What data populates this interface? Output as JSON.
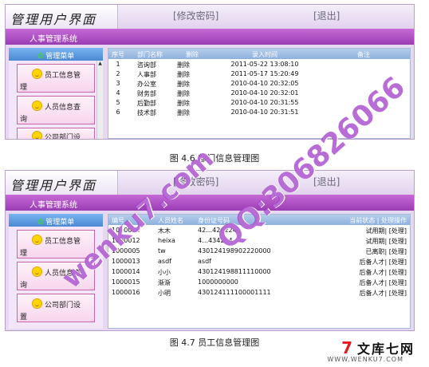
{
  "screen1": {
    "logo": "管理用户界面",
    "change_password": "[修改密码]",
    "logout": "[退出]",
    "system_title": "人事管理系统",
    "side_menu_title": "管理菜单",
    "menu": [
      {
        "label": "员工信息管",
        "label2": "理"
      },
      {
        "label": "人员信息查",
        "label2": "询"
      },
      {
        "label": "公司部门设",
        "label2": ""
      }
    ],
    "table": {
      "headers": [
        "序号",
        "部门名称",
        "删除",
        "录入时间",
        "备注"
      ],
      "rows": [
        {
          "no": "1",
          "name": "咨询部",
          "del": "删除",
          "time": "2011-05-22 13:08:10",
          "note": ""
        },
        {
          "no": "2",
          "name": "人事部",
          "del": "删除",
          "time": "2011-05-17 15:20:49",
          "note": ""
        },
        {
          "no": "3",
          "name": "办公室",
          "del": "删除",
          "time": "2010-04-10 20:32:05",
          "note": ""
        },
        {
          "no": "4",
          "name": "财务部",
          "del": "删除",
          "time": "2010-04-10 20:32:01",
          "note": ""
        },
        {
          "no": "5",
          "name": "后勤部",
          "del": "删除",
          "time": "2010-04-10 20:31:55",
          "note": ""
        },
        {
          "no": "6",
          "name": "技术部",
          "del": "删除",
          "time": "2010-04-10 20:31:51",
          "note": ""
        }
      ]
    }
  },
  "caption1": "图 4.6 部门信息管理图",
  "screen2": {
    "logo": "管理用户界面",
    "change_password": "[修改密码]",
    "logout": "[退出]",
    "system_title": "人事管理系统",
    "side_menu_title": "管理菜单",
    "menu": [
      {
        "label": "员工信息管",
        "label2": "理"
      },
      {
        "label": "人员信息查",
        "label2": "询"
      },
      {
        "label": "公司部门设",
        "label2": "置"
      }
    ],
    "table": {
      "headers": [
        "编号",
        "人员姓名",
        "身份证号码",
        "当前状态 | 处理操作"
      ],
      "rows": [
        {
          "id": "1000004",
          "name": "木木",
          "card": "42…4242242",
          "status": "试用期| [处理]"
        },
        {
          "id": "1000012",
          "name": "heixa",
          "card": "4…434234",
          "status": "试用期| [处理]"
        },
        {
          "id": "1000005",
          "name": "tw",
          "card": "430124198902220000",
          "status": "已离职| [处理]"
        },
        {
          "id": "1000013",
          "name": "asdf",
          "card": "asdf",
          "status": "后备人才| [处理]"
        },
        {
          "id": "1000014",
          "name": "小小",
          "card": "430124198811110000",
          "status": "后备人才| [处理]"
        },
        {
          "id": "1000015",
          "name": "渐渐",
          "card": "1000000000",
          "status": "后备人才| [处理]"
        },
        {
          "id": "1000016",
          "name": "小明",
          "card": "430124111100001111",
          "status": "后备人才| [处理]"
        }
      ]
    }
  },
  "caption2": "图 4.7 员工信息管理图",
  "watermark": {
    "left": "wenku7.com",
    "right": "QQ:306826066",
    "color": "#a03cc8"
  },
  "brand": {
    "name": "文库七网",
    "url": "WWW.WENKU7.COM"
  }
}
